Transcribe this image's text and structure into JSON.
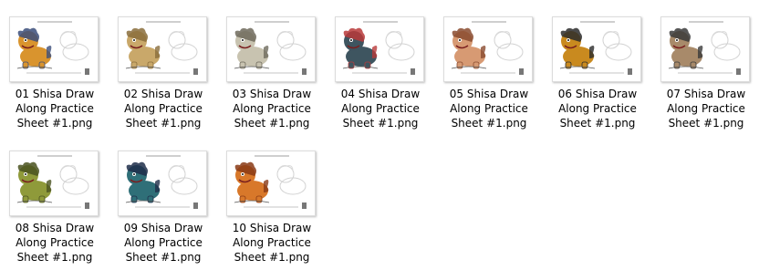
{
  "files": [
    {
      "name": "01 Shisa Draw\nAlong Practice\nSheet #1.png",
      "body_color": "#d9942e",
      "accent_color": "#3b4d7a"
    },
    {
      "name": "02 Shisa Draw\nAlong Practice\nSheet #1.png",
      "body_color": "#c9a86a",
      "accent_color": "#8a6d3b"
    },
    {
      "name": "03 Shisa Draw\nAlong Practice\nSheet #1.png",
      "body_color": "#c8c3b0",
      "accent_color": "#6e6a5c"
    },
    {
      "name": "04 Shisa Draw\nAlong Practice\nSheet #1.png",
      "body_color": "#3e5560",
      "accent_color": "#b83a3a"
    },
    {
      "name": "05 Shisa Draw\nAlong Practice\nSheet #1.png",
      "body_color": "#d79a73",
      "accent_color": "#8a4b2f"
    },
    {
      "name": "06 Shisa Draw\nAlong Practice\nSheet #1.png",
      "body_color": "#c98a1f",
      "accent_color": "#2b2b2b"
    },
    {
      "name": "07 Shisa Draw\nAlong Practice\nSheet #1.png",
      "body_color": "#a88a6a",
      "accent_color": "#3a3a3a"
    },
    {
      "name": "08 Shisa Draw\nAlong Practice\nSheet #1.png",
      "body_color": "#8f9a3a",
      "accent_color": "#4a5220"
    },
    {
      "name": "09 Shisa Draw\nAlong Practice\nSheet #1.png",
      "body_color": "#2f6f78",
      "accent_color": "#1f2e4a"
    },
    {
      "name": "10 Shisa Draw\nAlong Practice\nSheet #1.png",
      "body_color": "#d8782a",
      "accent_color": "#8a3a15"
    }
  ]
}
